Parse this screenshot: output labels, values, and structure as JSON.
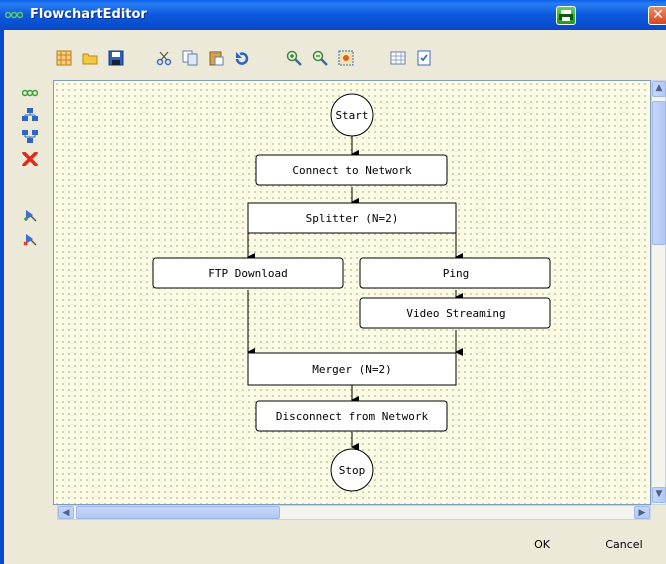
{
  "window": {
    "title": "FlowchartEditor",
    "close_label": "✕"
  },
  "toolbar": {
    "items": [
      {
        "name": "grid-new-icon"
      },
      {
        "name": "open-folder-icon"
      },
      {
        "name": "save-icon"
      },
      {
        "name": "cut-icon"
      },
      {
        "name": "copy-icon"
      },
      {
        "name": "paste-icon"
      },
      {
        "name": "undo-icon"
      },
      {
        "name": "zoom-in-icon"
      },
      {
        "name": "zoom-out-icon"
      },
      {
        "name": "zoom-fit-icon"
      },
      {
        "name": "table-icon"
      },
      {
        "name": "checklist-icon"
      }
    ]
  },
  "left_tools": [
    {
      "name": "connect-nodes-icon"
    },
    {
      "name": "hierarchy-down-icon"
    },
    {
      "name": "hierarchy-up-icon"
    },
    {
      "name": "delete-icon"
    },
    {
      "name": "add-node-icon"
    },
    {
      "name": "remove-node-icon"
    }
  ],
  "flowchart": {
    "nodes": {
      "start": "Start",
      "connect": "Connect to Network",
      "splitter": "Splitter (N=2)",
      "ftp": "FTP Download",
      "ping": "Ping",
      "video": "Video Streaming",
      "merger": "Merger (N=2)",
      "disconnect": "Disconnect from Network",
      "stop": "Stop"
    }
  },
  "buttons": {
    "ok": "OK",
    "cancel": "Cancel"
  },
  "colors": {
    "titlebar": "#0c59dc",
    "canvas_bg": "#fcfbe6",
    "node_border": "#000000"
  }
}
